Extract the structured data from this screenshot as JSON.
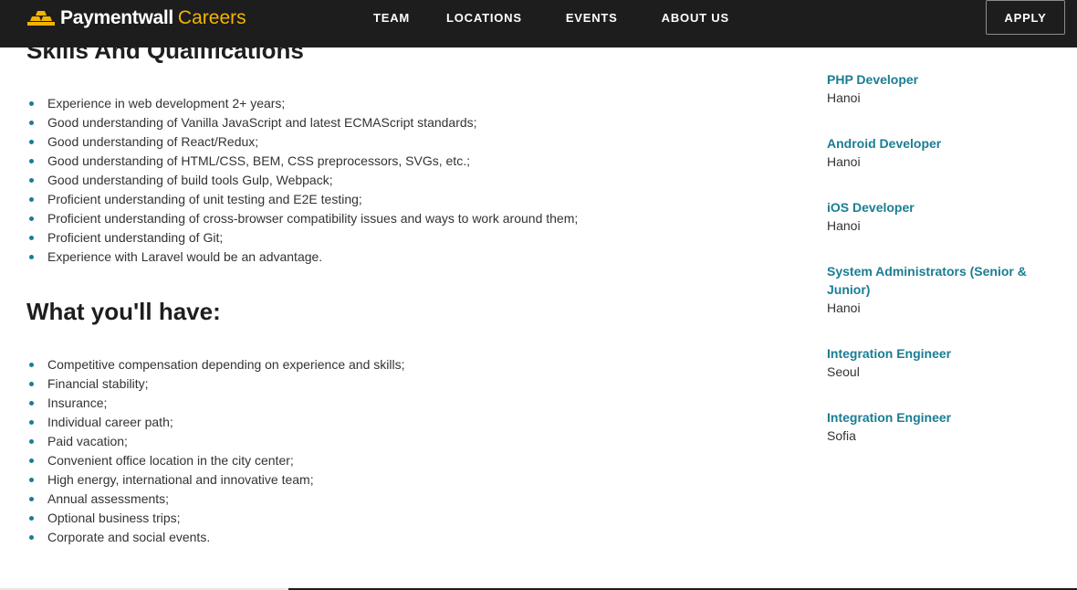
{
  "header": {
    "brand": "Paymentwall",
    "brand_sub": "Careers",
    "nav": [
      "TEAM",
      "LOCATIONS",
      "EVENTS",
      "ABOUT US"
    ],
    "apply_label": "APPLY",
    "accent_color": "#f4b400",
    "background_color": "#1d1d1d"
  },
  "main": {
    "partial_heading": "Skills And Qualifications",
    "skills": [
      "Experience in web development 2+ years;",
      "Good understanding of Vanilla JavaScript and latest ECMAScript standards;",
      "Good understanding of React/Redux;",
      "Good understanding of HTML/CSS, BEM, CSS preprocessors, SVGs, etc.;",
      "Good understanding of build tools Gulp, Webpack;",
      "Proficient understanding of unit testing and E2E testing;",
      "Proficient understanding of cross-browser compatibility issues and ways to work around them;",
      "Proficient understanding of Git;",
      "Experience with Laravel would be an advantage."
    ],
    "benefits_heading": "What you'll have:",
    "benefits": [
      "Competitive compensation depending on experience and skills;",
      "Financial stability;",
      "Insurance;",
      "Individual career path;",
      "Paid vacation;",
      "Convenient office location in the city center;",
      "High energy, international and innovative team;",
      "Annual assessments;",
      "Optional business trips;",
      "Corporate and social events."
    ],
    "bullet_color": "#1a7d93"
  },
  "sidebar": {
    "jobs": [
      {
        "title": "PHP Developer",
        "location": "Hanoi"
      },
      {
        "title": "Android Developer",
        "location": "Hanoi"
      },
      {
        "title": "iOS Developer",
        "location": "Hanoi"
      },
      {
        "title": "System Administrators (Senior & Junior)",
        "location": "Hanoi"
      },
      {
        "title": "Integration Engineer",
        "location": "Seoul"
      },
      {
        "title": "Integration Engineer",
        "location": "Sofia"
      }
    ],
    "link_color": "#1a7d93"
  }
}
